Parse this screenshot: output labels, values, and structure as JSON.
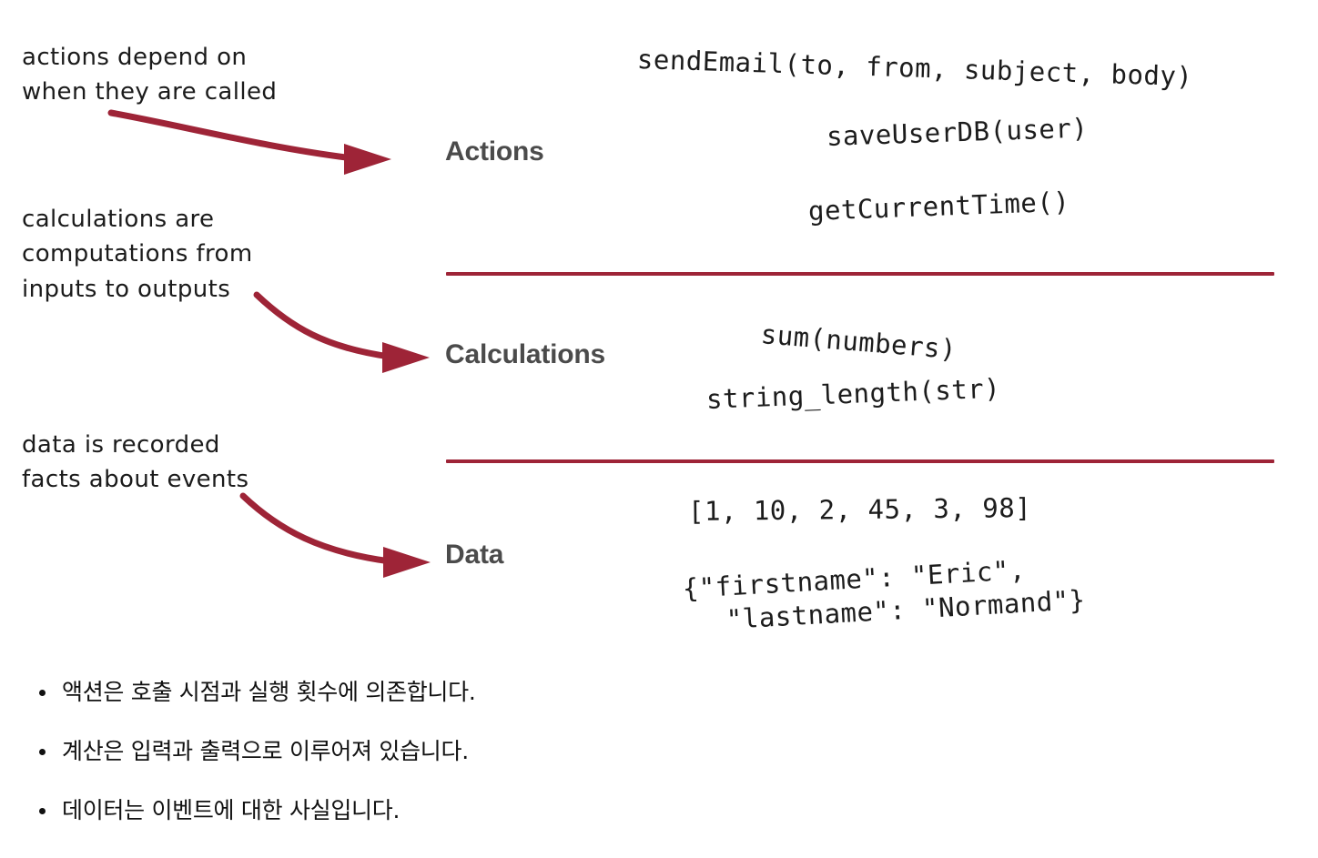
{
  "annotations": [
    {
      "id": "actions-note",
      "text": "actions depend on\nwhen they are called"
    },
    {
      "id": "calculations-note",
      "text": "calculations are\ncomputations from\ninputs to outputs"
    },
    {
      "id": "data-note",
      "text": "data is recorded\nfacts about events"
    }
  ],
  "categories": {
    "actions": "Actions",
    "calculations": "Calculations",
    "data": "Data"
  },
  "code": {
    "send_email": "sendEmail(to, from, subject, body)",
    "save_user_db": "saveUserDB(user)",
    "get_current_time": "getCurrentTime()",
    "sum_numbers": "sum(numbers)",
    "string_length": "string_length(str)",
    "array_literal": "[1, 10, 2, 45, 3, 98]",
    "json_line_1": "{\"firstname\": \"Eric\",",
    "json_line_2": " \"lastname\": \"Normand\"}"
  },
  "bullets": [
    "액션은 호출 시점과 실행 횟수에 의존합니다.",
    "계산은 입력과 출력으로 이루어져 있습니다.",
    "데이터는 이벤트에 대한 사실입니다."
  ],
  "colors": {
    "accent": "#9e2437",
    "label": "#4b4b4b",
    "text": "#1c1c1c",
    "background": "#ffffff"
  }
}
